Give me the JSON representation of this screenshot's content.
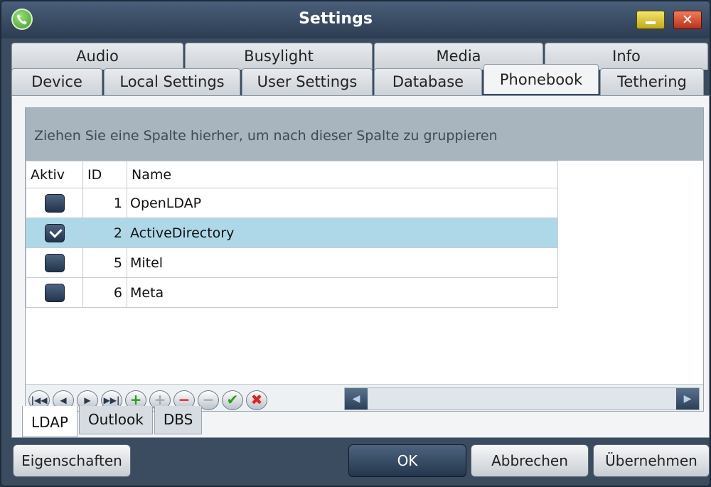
{
  "window": {
    "title": "Settings"
  },
  "tabs": {
    "top": [
      "Audio",
      "Busylight",
      "Media",
      "Info"
    ],
    "bottom": [
      "Device",
      "Local Settings",
      "User Settings",
      "Database",
      "Phonebook",
      "Tethering"
    ],
    "active": "Phonebook"
  },
  "grid": {
    "group_hint": "Ziehen Sie eine Spalte hierher, um nach dieser Spalte zu gruppieren",
    "columns": [
      "Aktiv",
      "ID",
      "Name"
    ],
    "rows": [
      {
        "active": false,
        "id": "1",
        "name": "OpenLDAP"
      },
      {
        "active": true,
        "id": "2",
        "name": "ActiveDirectory"
      },
      {
        "active": false,
        "id": "5",
        "name": "Mitel"
      },
      {
        "active": false,
        "id": "6",
        "name": "Meta"
      }
    ],
    "selected_row": 1
  },
  "navigator": {
    "buttons": [
      "first-icon",
      "prev-icon",
      "next-icon",
      "last-icon",
      "add-icon",
      "edit-icon",
      "delete-icon",
      "cancel-edit-icon",
      "confirm-icon",
      "discard-icon"
    ]
  },
  "subtabs": {
    "items": [
      "LDAP",
      "Outlook",
      "DBS"
    ],
    "active": "LDAP"
  },
  "buttons": {
    "properties": "Eigenschaften",
    "ok": "OK",
    "cancel": "Abbrechen",
    "apply": "Übernehmen"
  }
}
